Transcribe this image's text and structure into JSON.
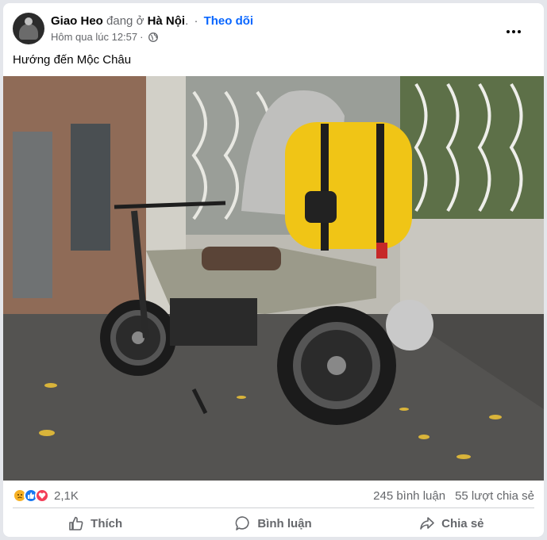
{
  "post": {
    "author": "Giao Heo",
    "status_prefix": "đang ở",
    "location": "Hà Nội",
    "location_suffix": ".",
    "separator": "·",
    "follow_label": "Theo dõi",
    "timestamp": "Hôm qua lúc 12:57",
    "timestamp_separator": "·",
    "privacy_icon": "globe-icon",
    "text": "Hướng đến Mộc Châu"
  },
  "stats": {
    "reactions": [
      "sad",
      "like",
      "love"
    ],
    "reaction_count": "2,1K",
    "comments": "245 bình luận",
    "shares": "55 lượt chia sẻ"
  },
  "actions": {
    "like_label": "Thích",
    "comment_label": "Bình luận",
    "share_label": "Chia sẻ"
  },
  "colors": {
    "accent": "#0866ff",
    "muted": "#65676b",
    "like": "#1877f2",
    "love": "#f33e58",
    "sad": "#f7b125"
  }
}
